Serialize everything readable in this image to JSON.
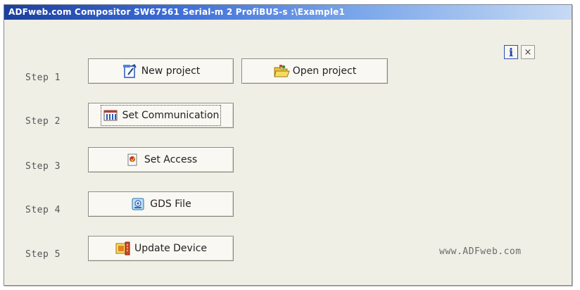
{
  "window": {
    "title": "ADFweb.com Compositor SW67561 Serial-m 2 ProfiBUS-s :\\Example1"
  },
  "steps": [
    {
      "label": "Step 1"
    },
    {
      "label": "Step 2"
    },
    {
      "label": "Step 3"
    },
    {
      "label": "Step 4"
    },
    {
      "label": "Step 5"
    }
  ],
  "buttons": {
    "new_project": "New project",
    "open_project": "Open project",
    "set_communication": "Set Communication",
    "set_access": "Set Access",
    "gds_file": "GDS File",
    "update_device": "Update Device"
  },
  "toolbar": {
    "info": "i",
    "close": "×"
  },
  "footer": {
    "url": "www.ADFweb.com"
  },
  "icons": {
    "new_project": "new-project-icon",
    "open_project": "folder-open-icon",
    "set_communication": "communication-grid-icon",
    "set_access": "access-icon",
    "gds_file": "gds-file-icon",
    "update_device": "update-device-icon"
  }
}
